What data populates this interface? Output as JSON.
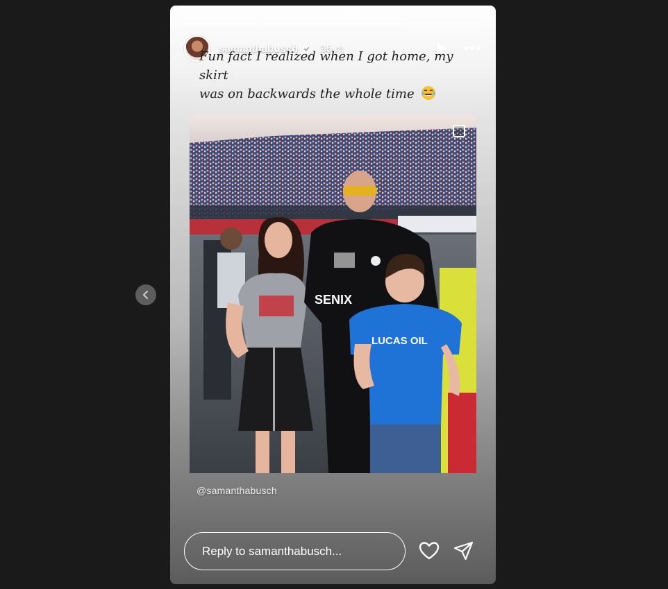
{
  "story": {
    "username": "samanthabusch",
    "time_ago": "36 m",
    "progress": [
      1.0,
      1.0,
      1.0,
      0.0
    ],
    "caption_line1": "Fun fact I realized when I got home, my skirt",
    "caption_line2": "was on backwards the whole time",
    "caption_emoji": "laughing-tears-emoji",
    "mention": "@samanthabusch",
    "reply_placeholder": "Reply to samanthabusch...",
    "photo_shirt_brand": "SENIX",
    "photo_kid_shirt": "LUCAS OIL"
  },
  "icons": {
    "verified": "verified-badge-icon",
    "play": "play-icon",
    "more": "more-icon",
    "heart": "heart-icon",
    "send": "send-icon",
    "prev": "chevron-left-icon"
  },
  "colors": {
    "page_bg": "#1a1a1a",
    "verified_blue": "#ffffff",
    "kid_shirt": "#1f72d6"
  }
}
